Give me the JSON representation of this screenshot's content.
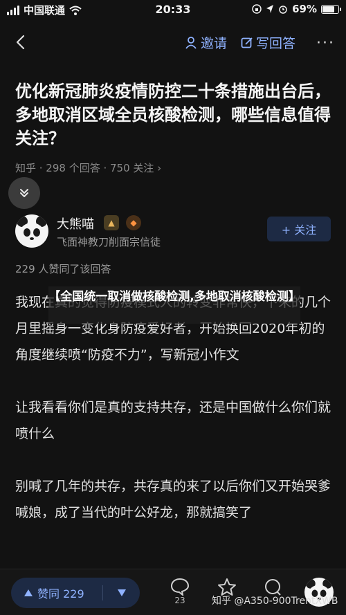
{
  "status_bar": {
    "carrier": "中国联通",
    "time": "20:33",
    "battery": "69%",
    "battery_level": 0.69
  },
  "nav": {
    "invite_label": "邀请",
    "write_label": "写回答",
    "more_label": "···"
  },
  "question": {
    "title": "优化新冠肺炎疫情防控二十条措施出台后，多地取消区域全员核酸检测，哪些信息值得关注？",
    "meta": "知乎 · 298 个回答 · 750 关注 ›"
  },
  "author": {
    "name": "大熊喵",
    "description": "飞面神教刀削面宗信徒",
    "follow_label": "+ 关注"
  },
  "answer": {
    "likes_text": "229 人赞同了该回答",
    "paragraphs": [
      "我现在真的觉得防疫模式人的转变非常快，下来的几个月里摇身一变化身防疫爱好者，开始换回2020年初的角度继续喷“防疫不力”，写新冠小作文",
      "让我看看你们是真的支持共存，还是中国做什么你们就喷什么",
      "别喊了几年的共存，共存真的来了以后你们又开始哭爹喊娘，成了当代的叶公好龙，那就搞笑了"
    ]
  },
  "banner": {
    "text": "【全国统一取消做核酸检测,多地取消核酸检测】"
  },
  "bottom_bar": {
    "vote_label": "赞同 229",
    "comment_count": "23",
    "watermark": "知乎 @A350-900TrentXWB"
  },
  "colors": {
    "background": "#121212",
    "accent": "#8fb2ff"
  }
}
